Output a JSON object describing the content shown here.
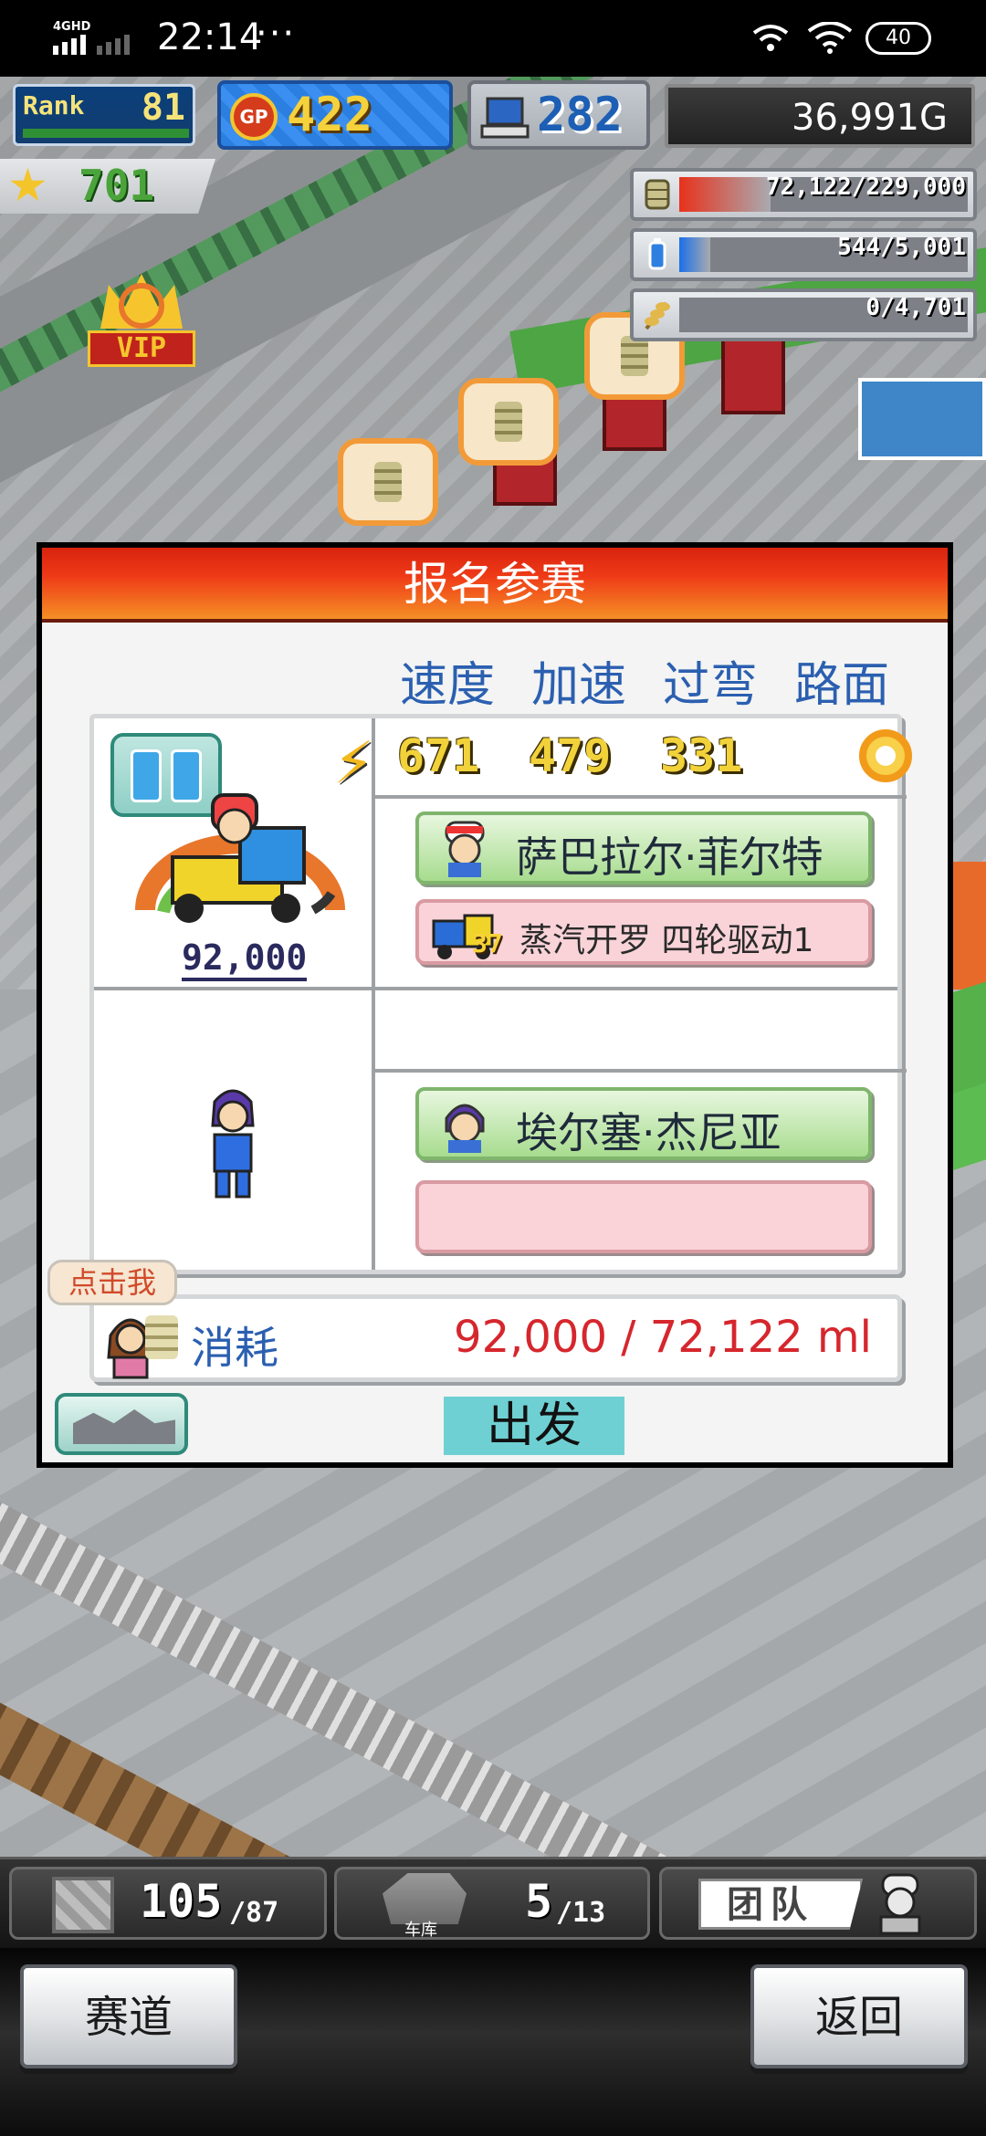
{
  "status_bar": {
    "network": "4GHD",
    "time": "22:14",
    "overflow": "···",
    "battery": "40"
  },
  "hud": {
    "rank_label": "Rank",
    "rank_value": "81",
    "gp_icon": "GP",
    "gp_value": "422",
    "research_value": "282",
    "money": "36,991G",
    "stars": "701"
  },
  "resources": [
    {
      "icon": "coin-stack-icon",
      "value": "72,122/229,000",
      "fill_fraction": 0.315,
      "color": "#e8321c"
    },
    {
      "icon": "fuel-can-icon",
      "value": "544/5,001",
      "fill_fraction": 0.109,
      "color": "#1c6fe8"
    },
    {
      "icon": "wheat-icon",
      "value": "0/4,701",
      "fill_fraction": 0,
      "color": "#7b7b7b"
    }
  ],
  "map": {
    "vip_label": "VIP"
  },
  "dialog": {
    "title": "报名参赛",
    "column_headers": [
      "速度",
      "加速",
      "过弯",
      "路面"
    ],
    "kart_cost": "92,000",
    "stats": [
      "671",
      "479",
      "331"
    ],
    "driver_1_name": "萨巴拉尔·菲尔特",
    "car_level": "37",
    "car_name": "蒸汽开罗 四轮驱动1",
    "driver_2_name": "埃尔塞·杰尼亚",
    "car_2_name": "",
    "click_me": "点击我",
    "consume_label": "消耗",
    "consume_value": "92,000 / 72,122 ml",
    "depart_label": "出发"
  },
  "bottom_stats": {
    "crates_current": "105",
    "crates_max": "/87",
    "garage_label": "车库",
    "garage_current": "5",
    "garage_max": "/13",
    "team_label": "团队"
  },
  "bottom_nav": {
    "track_label": "赛道",
    "back_label": "返回"
  }
}
